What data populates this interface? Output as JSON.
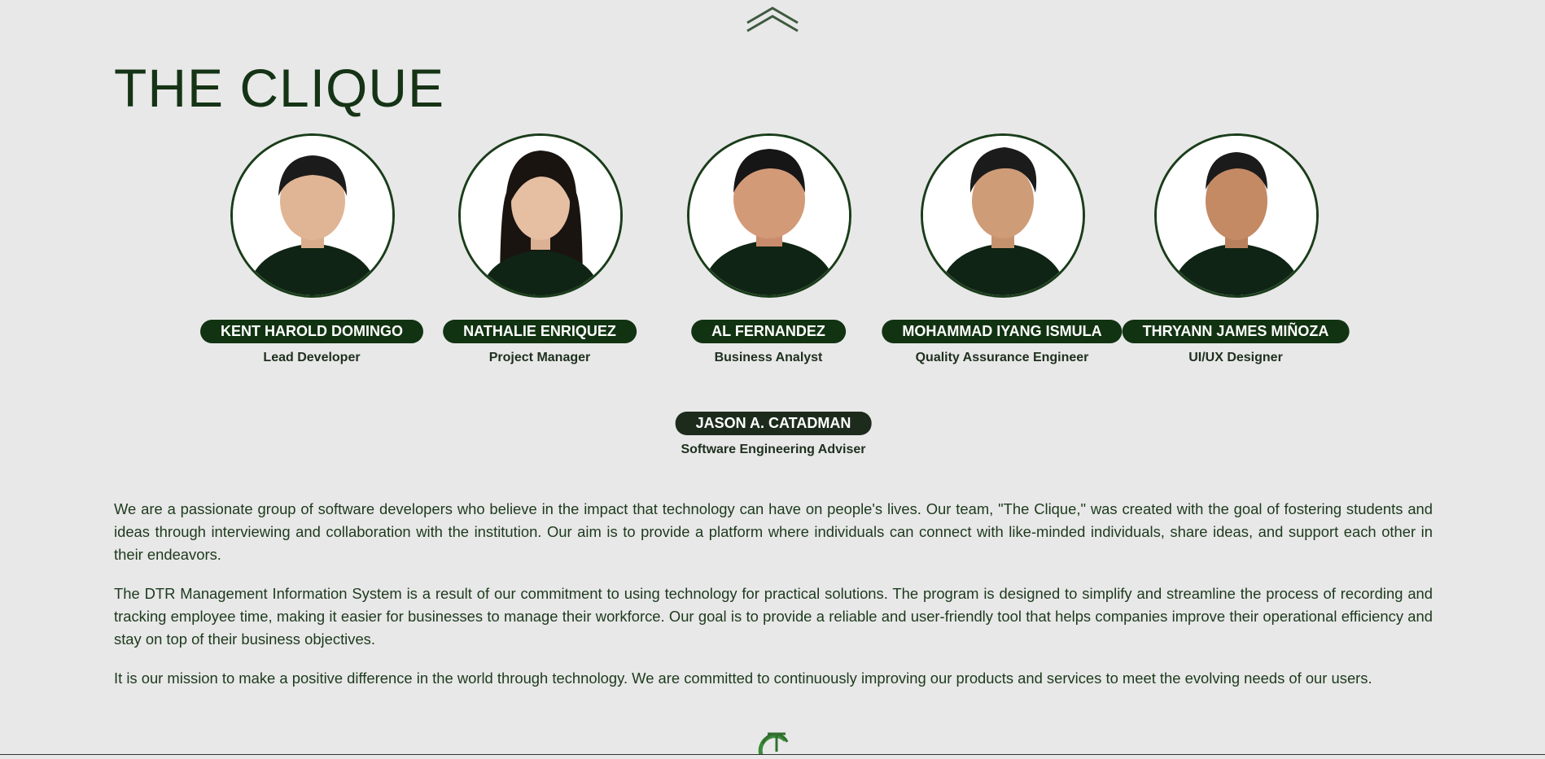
{
  "page": {
    "title": "THE CLIQUE"
  },
  "colors": {
    "background": "#e8e8e8",
    "accent_green": "#123312",
    "title_green": "#153315",
    "logo_green": "#3a8a3a"
  },
  "icons": {
    "scroll_up": "double-chevron-up-icon",
    "footer_logo": "clique-logo-icon"
  },
  "members": [
    {
      "name": "KENT HAROLD DOMINGO",
      "role": "Lead Developer"
    },
    {
      "name": "NATHALIE ENRIQUEZ",
      "role": "Project Manager"
    },
    {
      "name": "AL FERNANDEZ",
      "role": "Business Analyst"
    },
    {
      "name": "MOHAMMAD IYANG ISMULA",
      "role": "Quality Assurance Engineer"
    },
    {
      "name": "THRYANN JAMES MIÑOZA",
      "role": "UI/UX Designer"
    }
  ],
  "adviser": {
    "name": "JASON A. CATADMAN",
    "role": "Software Engineering Adviser"
  },
  "about": {
    "paragraphs": [
      "We are a passionate group of software developers who believe in the impact that technology can have on people's lives. Our team, \"The Clique,\" was created with the goal of fostering students and ideas through interviewing and collaboration with the institution. Our aim is to provide a platform where individuals can connect with like-minded individuals, share ideas, and support each other in their endeavors.",
      "The DTR Management Information System is a result of our commitment to using technology for practical solutions. The program is designed to simplify and streamline the process of recording and tracking employee time, making it easier for businesses to manage their workforce. Our goal is to provide a reliable and user-friendly tool that helps companies improve their operational efficiency and stay on top of their business objectives.",
      "It is our mission to make a positive difference in the world through technology. We are committed to continuously improving our products and services to meet the evolving needs of our users."
    ]
  }
}
